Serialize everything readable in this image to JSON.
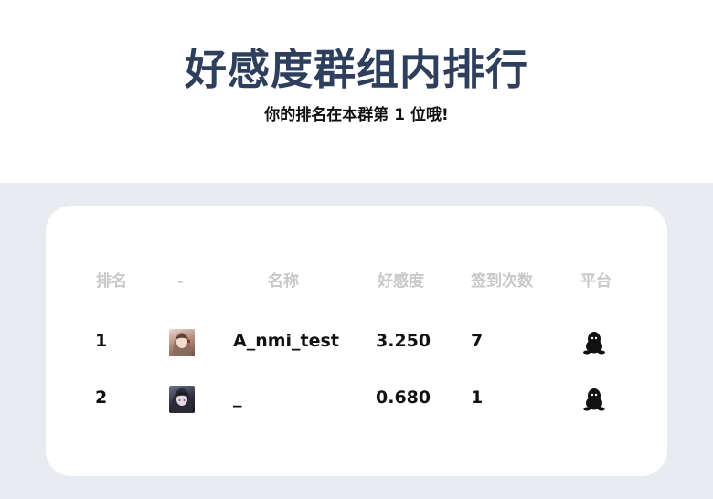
{
  "header": {
    "title": "好感度群组内排行",
    "subtitle": "你的排名在本群第 1 位哦!"
  },
  "table": {
    "columns": [
      "排名",
      "-",
      "名称",
      "好感度",
      "签到次数",
      "平台"
    ],
    "rows": [
      {
        "rank": "1",
        "avatar": "user-avatar",
        "name": "A_nmi_test",
        "favorability": "3.250",
        "sign_count": "7",
        "platform_icon": "qq-penguin-icon"
      },
      {
        "rank": "2",
        "avatar": "user-avatar",
        "name": "_",
        "favorability": "0.680",
        "sign_count": "1",
        "platform_icon": "qq-penguin-icon"
      }
    ]
  },
  "colors": {
    "title": "#2d3f5c",
    "page_background": "#e8ebf0",
    "card": "#ffffff",
    "header_text": "#c8c8c8"
  }
}
